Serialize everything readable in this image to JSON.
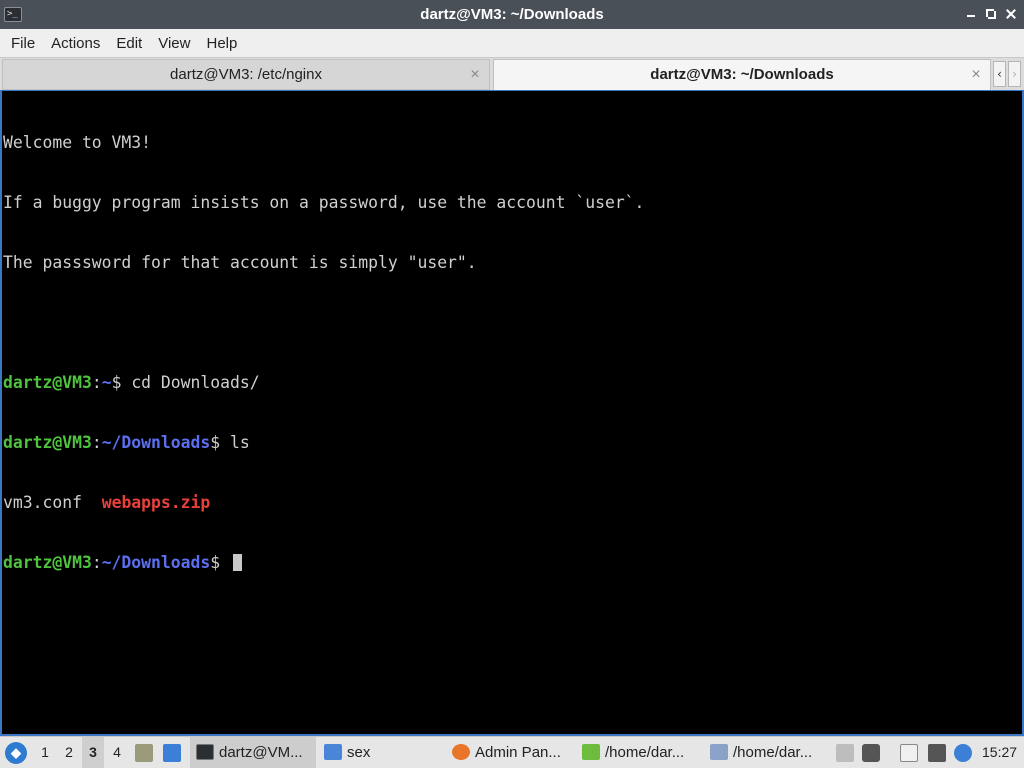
{
  "window": {
    "title": "dartz@VM3: ~/Downloads",
    "app_icon": "terminal-icon",
    "app_icon_glyph": ">_"
  },
  "menu": [
    "File",
    "Actions",
    "Edit",
    "View",
    "Help"
  ],
  "tabs": [
    {
      "label": "dartz@VM3: /etc/nginx",
      "active": false,
      "close": "×"
    },
    {
      "label": "dartz@VM3: ~/Downloads",
      "active": true,
      "close": "×"
    }
  ],
  "tab_scroll": {
    "left": "‹",
    "right": "›"
  },
  "terminal": {
    "welcome": [
      "Welcome to VM3!",
      "If a buggy program insists on a password, use the account `user`.",
      "The passsword for that account is simply \"user\"."
    ],
    "cmd1": {
      "user": "dartz@VM3",
      "sep": ":",
      "path": "~",
      "prompt": "$ ",
      "command": "cd Downloads/"
    },
    "cmd2": {
      "user": "dartz@VM3",
      "sep": ":",
      "path": "~/Downloads",
      "prompt": "$ ",
      "command": "ls"
    },
    "ls_output": {
      "file1": "vm3.conf",
      "gap": "  ",
      "file2": "webapps.zip"
    },
    "cmd3": {
      "user": "dartz@VM3",
      "sep": ":",
      "path": "~/Downloads",
      "prompt": "$ "
    },
    "colors": {
      "user": "#4fc23f",
      "path": "#5b6ff0",
      "archive": "#e8413a",
      "text": "#d0d0d0",
      "background": "#000000"
    }
  },
  "taskbar": {
    "start_icon": "start-menu-icon",
    "workspaces": [
      "1",
      "2",
      "3",
      "4"
    ],
    "active_workspace": "3",
    "tasks": [
      {
        "label": "dartz@VM...",
        "icon": "terminal-icon",
        "active": true
      },
      {
        "label": "sex",
        "icon": "folder-icon",
        "active": false
      },
      {
        "label": "Admin Pan...",
        "icon": "firefox-icon",
        "active": false
      },
      {
        "label": "/home/dar...",
        "icon": "archive-icon",
        "active": false
      },
      {
        "label": "/home/dar...",
        "icon": "text-editor-icon",
        "active": false
      }
    ],
    "clock": "15:27"
  }
}
